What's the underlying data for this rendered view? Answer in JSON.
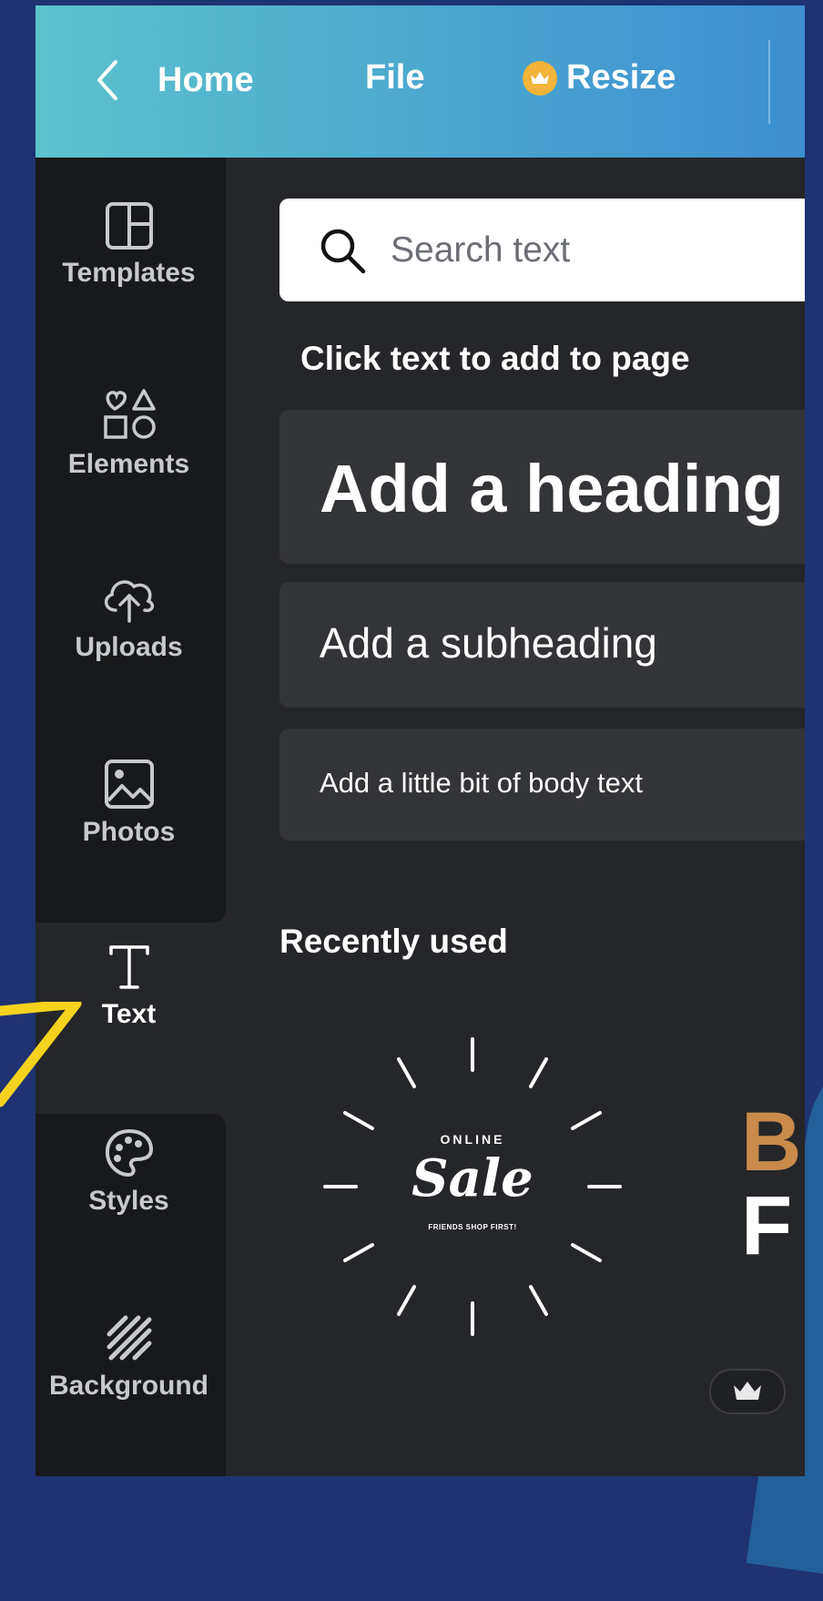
{
  "topbar": {
    "home_label": "Home",
    "file_label": "File",
    "resize_label": "Resize"
  },
  "sidebar": {
    "items": [
      {
        "label": "Templates",
        "icon": "layout-icon"
      },
      {
        "label": "Elements",
        "icon": "shapes-icon"
      },
      {
        "label": "Uploads",
        "icon": "cloud-upload-icon"
      },
      {
        "label": "Photos",
        "icon": "image-icon"
      },
      {
        "label": "Text",
        "icon": "text-icon",
        "active": true
      },
      {
        "label": "Styles",
        "icon": "palette-icon"
      },
      {
        "label": "Background",
        "icon": "hatch-icon"
      }
    ]
  },
  "panel": {
    "search_placeholder": "Search text",
    "hint": "Click text to add to page",
    "heading": "Add a heading",
    "subheading": "Add a subheading",
    "body": "Add a little bit of body text",
    "recently_used": "Recently used"
  },
  "recent_items": [
    {
      "line1": "ONLINE",
      "line2": "Sale",
      "line3": "FRIENDS SHOP FIRST!"
    },
    {
      "line1": "B",
      "line2": "F"
    }
  ],
  "colors": {
    "highlight_arrow": "#f5d21e",
    "topbar_start": "#5cc2cc",
    "topbar_end": "#3d8fd0",
    "crown_badge": "#f2b43a"
  }
}
